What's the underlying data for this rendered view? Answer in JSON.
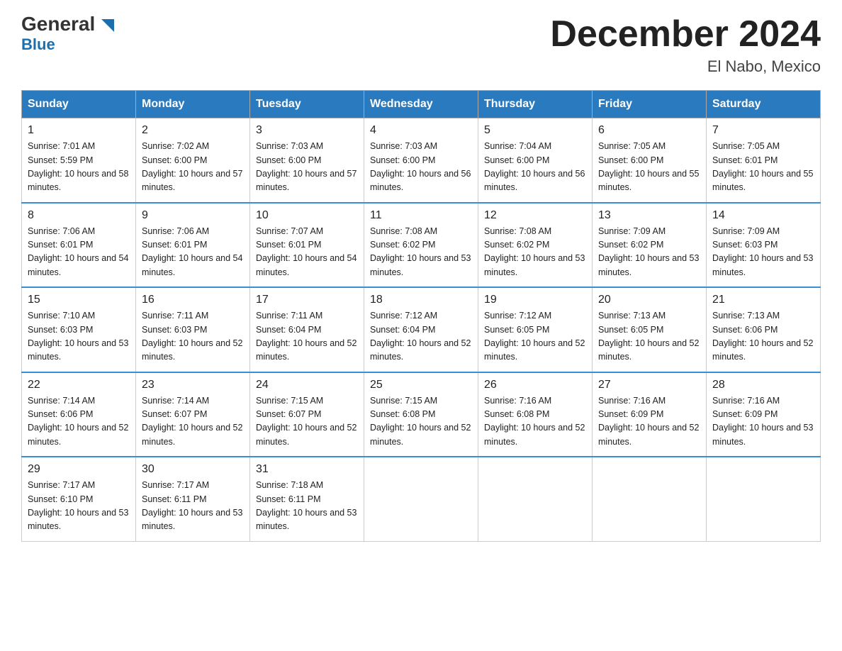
{
  "logo": {
    "name_part1": "General",
    "name_part2": "Blue"
  },
  "title": "December 2024",
  "subtitle": "El Nabo, Mexico",
  "days_of_week": [
    "Sunday",
    "Monday",
    "Tuesday",
    "Wednesday",
    "Thursday",
    "Friday",
    "Saturday"
  ],
  "weeks": [
    [
      {
        "num": "1",
        "sunrise": "7:01 AM",
        "sunset": "5:59 PM",
        "daylight": "10 hours and 58 minutes."
      },
      {
        "num": "2",
        "sunrise": "7:02 AM",
        "sunset": "6:00 PM",
        "daylight": "10 hours and 57 minutes."
      },
      {
        "num": "3",
        "sunrise": "7:03 AM",
        "sunset": "6:00 PM",
        "daylight": "10 hours and 57 minutes."
      },
      {
        "num": "4",
        "sunrise": "7:03 AM",
        "sunset": "6:00 PM",
        "daylight": "10 hours and 56 minutes."
      },
      {
        "num": "5",
        "sunrise": "7:04 AM",
        "sunset": "6:00 PM",
        "daylight": "10 hours and 56 minutes."
      },
      {
        "num": "6",
        "sunrise": "7:05 AM",
        "sunset": "6:00 PM",
        "daylight": "10 hours and 55 minutes."
      },
      {
        "num": "7",
        "sunrise": "7:05 AM",
        "sunset": "6:01 PM",
        "daylight": "10 hours and 55 minutes."
      }
    ],
    [
      {
        "num": "8",
        "sunrise": "7:06 AM",
        "sunset": "6:01 PM",
        "daylight": "10 hours and 54 minutes."
      },
      {
        "num": "9",
        "sunrise": "7:06 AM",
        "sunset": "6:01 PM",
        "daylight": "10 hours and 54 minutes."
      },
      {
        "num": "10",
        "sunrise": "7:07 AM",
        "sunset": "6:01 PM",
        "daylight": "10 hours and 54 minutes."
      },
      {
        "num": "11",
        "sunrise": "7:08 AM",
        "sunset": "6:02 PM",
        "daylight": "10 hours and 53 minutes."
      },
      {
        "num": "12",
        "sunrise": "7:08 AM",
        "sunset": "6:02 PM",
        "daylight": "10 hours and 53 minutes."
      },
      {
        "num": "13",
        "sunrise": "7:09 AM",
        "sunset": "6:02 PM",
        "daylight": "10 hours and 53 minutes."
      },
      {
        "num": "14",
        "sunrise": "7:09 AM",
        "sunset": "6:03 PM",
        "daylight": "10 hours and 53 minutes."
      }
    ],
    [
      {
        "num": "15",
        "sunrise": "7:10 AM",
        "sunset": "6:03 PM",
        "daylight": "10 hours and 53 minutes."
      },
      {
        "num": "16",
        "sunrise": "7:11 AM",
        "sunset": "6:03 PM",
        "daylight": "10 hours and 52 minutes."
      },
      {
        "num": "17",
        "sunrise": "7:11 AM",
        "sunset": "6:04 PM",
        "daylight": "10 hours and 52 minutes."
      },
      {
        "num": "18",
        "sunrise": "7:12 AM",
        "sunset": "6:04 PM",
        "daylight": "10 hours and 52 minutes."
      },
      {
        "num": "19",
        "sunrise": "7:12 AM",
        "sunset": "6:05 PM",
        "daylight": "10 hours and 52 minutes."
      },
      {
        "num": "20",
        "sunrise": "7:13 AM",
        "sunset": "6:05 PM",
        "daylight": "10 hours and 52 minutes."
      },
      {
        "num": "21",
        "sunrise": "7:13 AM",
        "sunset": "6:06 PM",
        "daylight": "10 hours and 52 minutes."
      }
    ],
    [
      {
        "num": "22",
        "sunrise": "7:14 AM",
        "sunset": "6:06 PM",
        "daylight": "10 hours and 52 minutes."
      },
      {
        "num": "23",
        "sunrise": "7:14 AM",
        "sunset": "6:07 PM",
        "daylight": "10 hours and 52 minutes."
      },
      {
        "num": "24",
        "sunrise": "7:15 AM",
        "sunset": "6:07 PM",
        "daylight": "10 hours and 52 minutes."
      },
      {
        "num": "25",
        "sunrise": "7:15 AM",
        "sunset": "6:08 PM",
        "daylight": "10 hours and 52 minutes."
      },
      {
        "num": "26",
        "sunrise": "7:16 AM",
        "sunset": "6:08 PM",
        "daylight": "10 hours and 52 minutes."
      },
      {
        "num": "27",
        "sunrise": "7:16 AM",
        "sunset": "6:09 PM",
        "daylight": "10 hours and 52 minutes."
      },
      {
        "num": "28",
        "sunrise": "7:16 AM",
        "sunset": "6:09 PM",
        "daylight": "10 hours and 53 minutes."
      }
    ],
    [
      {
        "num": "29",
        "sunrise": "7:17 AM",
        "sunset": "6:10 PM",
        "daylight": "10 hours and 53 minutes."
      },
      {
        "num": "30",
        "sunrise": "7:17 AM",
        "sunset": "6:11 PM",
        "daylight": "10 hours and 53 minutes."
      },
      {
        "num": "31",
        "sunrise": "7:18 AM",
        "sunset": "6:11 PM",
        "daylight": "10 hours and 53 minutes."
      },
      null,
      null,
      null,
      null
    ]
  ]
}
